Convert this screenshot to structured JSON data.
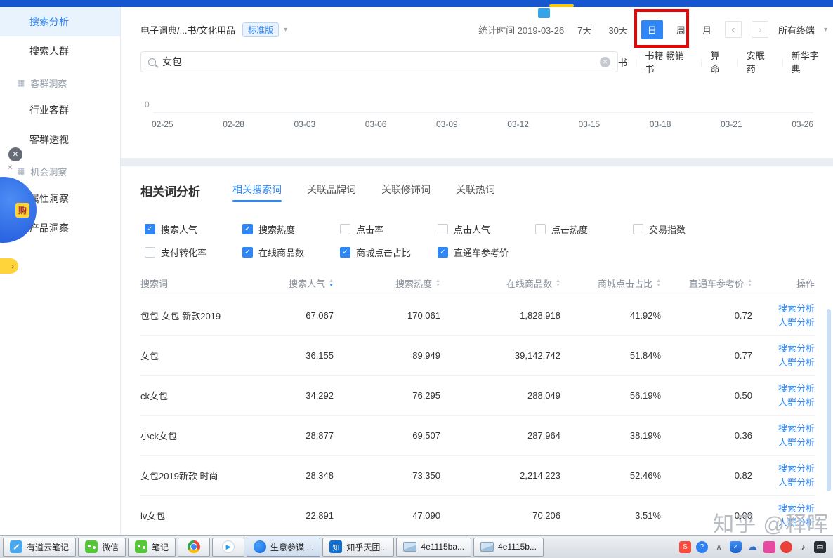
{
  "colors": {
    "accent": "#2e86f7",
    "annotation_red": "#ec0404",
    "topbar_blue": "#1657d0"
  },
  "sidebar": {
    "items": [
      {
        "label": "搜索分析",
        "type": "item",
        "active": true
      },
      {
        "label": "搜索人群",
        "type": "item",
        "active": false
      },
      {
        "label": "客群洞察",
        "type": "section",
        "active": false
      },
      {
        "label": "行业客群",
        "type": "item",
        "active": false
      },
      {
        "label": "客群透视",
        "type": "item",
        "active": false
      },
      {
        "label": "机会洞察",
        "type": "section",
        "active": false
      },
      {
        "label": "属性洞察",
        "type": "item",
        "active": false
      },
      {
        "label": "产品洞察",
        "type": "item",
        "active": false
      }
    ],
    "float_ad": {
      "close_icon": "✕",
      "badge_text": "购"
    }
  },
  "header": {
    "breadcrumb": "电子词典/...书/文化用品",
    "version_badge": "标准版",
    "stat_time": "统计时间 2019-03-26",
    "range_buttons": [
      {
        "label": "7天",
        "active": false
      },
      {
        "label": "30天",
        "active": false
      },
      {
        "label": "日",
        "active": true
      },
      {
        "label": "周",
        "active": false
      },
      {
        "label": "月",
        "active": false
      }
    ],
    "terminal_selector": "所有终端"
  },
  "search": {
    "query": "女包",
    "hot_links": [
      "书",
      "书籍 畅销书",
      "算命",
      "安眠药",
      "新华字典"
    ]
  },
  "chart": {
    "y_label": "0",
    "x_labels": [
      "02-25",
      "02-28",
      "03-03",
      "03-06",
      "03-09",
      "03-12",
      "03-15",
      "03-18",
      "03-21",
      "03-26"
    ]
  },
  "analysis": {
    "title": "相关词分析",
    "tabs": [
      {
        "label": "相关搜索词",
        "active": true
      },
      {
        "label": "关联品牌词",
        "active": false
      },
      {
        "label": "关联修饰词",
        "active": false
      },
      {
        "label": "关联热词",
        "active": false
      }
    ],
    "metrics": [
      {
        "label": "搜索人气",
        "checked": true
      },
      {
        "label": "搜索热度",
        "checked": true
      },
      {
        "label": "点击率",
        "checked": false
      },
      {
        "label": "点击人气",
        "checked": false
      },
      {
        "label": "点击热度",
        "checked": false
      },
      {
        "label": "交易指数",
        "checked": false
      },
      {
        "label": "支付转化率",
        "checked": false
      },
      {
        "label": "在线商品数",
        "checked": true
      },
      {
        "label": "商城点击占比",
        "checked": true
      },
      {
        "label": "直通车参考价",
        "checked": true
      }
    ]
  },
  "table": {
    "columns": [
      {
        "label": "搜索词",
        "sortable": false,
        "align": "left"
      },
      {
        "label": "搜索人气",
        "sortable": true,
        "sorted": "desc",
        "align": "right"
      },
      {
        "label": "搜索热度",
        "sortable": true,
        "align": "right"
      },
      {
        "label": "在线商品数",
        "sortable": true,
        "align": "right"
      },
      {
        "label": "商城点击占比",
        "sortable": true,
        "align": "right"
      },
      {
        "label": "直通车参考价",
        "sortable": true,
        "align": "right"
      },
      {
        "label": "操作",
        "sortable": false,
        "align": "right"
      }
    ],
    "action_labels": [
      "搜索分析",
      "人群分析"
    ],
    "rows": [
      {
        "keyword": "包包 女包 新款2019",
        "values": [
          "67,067",
          "170,061",
          "1,828,918",
          "41.92%",
          "0.72"
        ]
      },
      {
        "keyword": "女包",
        "values": [
          "36,155",
          "89,949",
          "39,142,742",
          "51.84%",
          "0.77"
        ]
      },
      {
        "keyword": "ck女包",
        "values": [
          "34,292",
          "76,295",
          "288,049",
          "56.19%",
          "0.50"
        ]
      },
      {
        "keyword": "小ck女包",
        "values": [
          "28,877",
          "69,507",
          "287,964",
          "38.19%",
          "0.36"
        ]
      },
      {
        "keyword": "女包2019新款 时尚",
        "values": [
          "28,348",
          "73,350",
          "2,214,223",
          "52.46%",
          "0.82"
        ]
      },
      {
        "keyword": "lv女包",
        "values": [
          "22,891",
          "47,090",
          "70,206",
          "3.51%",
          "0.00"
        ]
      }
    ]
  },
  "watermark": "知乎 @释晖",
  "taskbar": {
    "items": [
      {
        "label": "有道云笔记",
        "icon": "youdao-note-icon",
        "active": false
      },
      {
        "label": "微信",
        "icon": "wechat-icon",
        "active": false
      },
      {
        "label": "笔记",
        "icon": "wechat-icon",
        "active": false
      },
      {
        "label": "",
        "icon": "chrome-icon",
        "active": false
      },
      {
        "label": "",
        "icon": "tencent-video-icon",
        "active": false
      },
      {
        "label": "生意参谋 ...",
        "icon": "sycm-icon",
        "active": true
      },
      {
        "label": "知乎天团...",
        "icon": "zhihu-icon",
        "active": false
      },
      {
        "label": "4e1115ba...",
        "icon": "image-thumbnail-icon",
        "active": false
      },
      {
        "label": "4e1115b...",
        "icon": "image-thumbnail-icon",
        "active": false
      }
    ],
    "tray_icons": [
      "sogou-icon",
      "help-icon",
      "up-arrow-icon",
      "defender-shield-icon",
      "onedrive-icon",
      "pink-app-icon",
      "red-app-icon",
      "volume-icon",
      "input-method-icon"
    ]
  }
}
